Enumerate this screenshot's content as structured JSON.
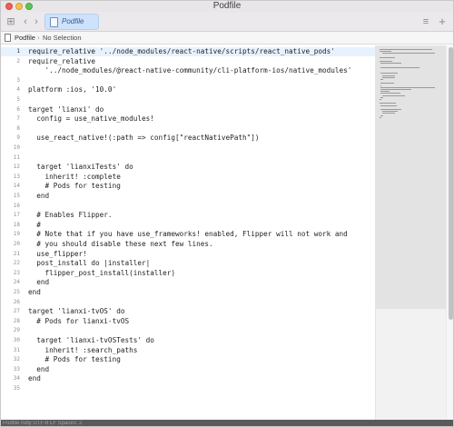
{
  "window": {
    "title": "Podfile"
  },
  "toolbar": {
    "grid_icon": "⊞",
    "back_icon": "‹",
    "forward_icon": "›",
    "tab_label": "Podfile",
    "lines_icon": "≡",
    "add_icon": "+"
  },
  "jumpbar": {
    "file": "Podfile",
    "separator": "›",
    "selection": "No Selection"
  },
  "editor": {
    "active_line": 1,
    "lines": [
      {
        "n": "1",
        "text": "require_relative '../node_modules/react-native/scripts/react_native_pods'"
      },
      {
        "n": "2",
        "text": "require_relative"
      },
      {
        "n": "",
        "text": "    '../node_modules/@react-native-community/cli-platform-ios/native_modules'"
      },
      {
        "n": "3",
        "text": ""
      },
      {
        "n": "4",
        "text": "platform :ios, '10.0'"
      },
      {
        "n": "5",
        "text": ""
      },
      {
        "n": "6",
        "text": "target 'lianxi' do"
      },
      {
        "n": "7",
        "text": "  config = use_native_modules!"
      },
      {
        "n": "8",
        "text": ""
      },
      {
        "n": "9",
        "text": "  use_react_native!(:path => config[\"reactNativePath\"])"
      },
      {
        "n": "10",
        "text": ""
      },
      {
        "n": "11",
        "text": ""
      },
      {
        "n": "12",
        "text": "  target 'lianxiTests' do"
      },
      {
        "n": "13",
        "text": "    inherit! :complete"
      },
      {
        "n": "14",
        "text": "    # Pods for testing"
      },
      {
        "n": "15",
        "text": "  end"
      },
      {
        "n": "16",
        "text": ""
      },
      {
        "n": "17",
        "text": "  # Enables Flipper."
      },
      {
        "n": "18",
        "text": "  #"
      },
      {
        "n": "19",
        "text": "  # Note that if you have use_frameworks! enabled, Flipper will not work and"
      },
      {
        "n": "20",
        "text": "  # you should disable these next few lines."
      },
      {
        "n": "21",
        "text": "  use_flipper!"
      },
      {
        "n": "22",
        "text": "  post_install do |installer|"
      },
      {
        "n": "23",
        "text": "    flipper_post_install(installer)"
      },
      {
        "n": "24",
        "text": "  end"
      },
      {
        "n": "25",
        "text": "end"
      },
      {
        "n": "26",
        "text": ""
      },
      {
        "n": "27",
        "text": "target 'lianxi-tvOS' do"
      },
      {
        "n": "28",
        "text": "  # Pods for lianxi-tvOS"
      },
      {
        "n": "29",
        "text": ""
      },
      {
        "n": "30",
        "text": "  target 'lianxi-tvOSTests' do"
      },
      {
        "n": "31",
        "text": "    inherit! :search_paths"
      },
      {
        "n": "32",
        "text": "    # Pods for testing"
      },
      {
        "n": "33",
        "text": "  end"
      },
      {
        "n": "34",
        "text": "end"
      },
      {
        "n": "35",
        "text": ""
      }
    ]
  },
  "bottombar": {
    "text": "Podfile  ruby  UTF-8  LF  Spaces: 2"
  },
  "colors": {
    "active_line": "#e8f2ff",
    "tab_background": "#cfe2fb",
    "tab_text": "#2e5d97"
  }
}
